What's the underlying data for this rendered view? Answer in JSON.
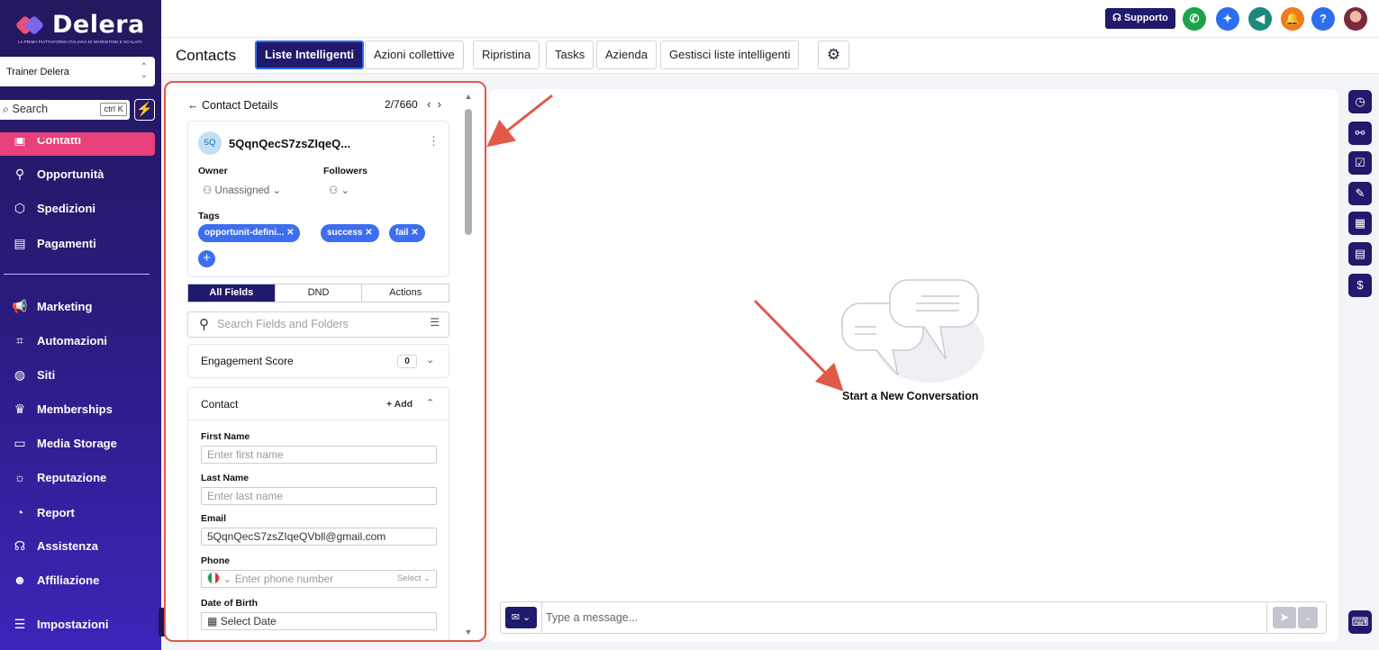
{
  "sidebar": {
    "logo": "Delera",
    "logo_tagline": "LA PRIMA PIATTAFORMA ITALIANA DI MARKETING E SCALATA",
    "account": "Trainer Delera",
    "search_label": "Search",
    "search_shortcut": "ctrl K",
    "items": [
      {
        "label": "Contatti",
        "icon": "contacts-icon"
      },
      {
        "label": "Opportunità",
        "icon": "filter-icon"
      },
      {
        "label": "Spedizioni",
        "icon": "box-icon"
      },
      {
        "label": "Pagamenti",
        "icon": "receipt-icon"
      },
      {
        "label": "Marketing",
        "icon": "megaphone-icon"
      },
      {
        "label": "Automazioni",
        "icon": "workflow-icon"
      },
      {
        "label": "Siti",
        "icon": "globe-icon"
      },
      {
        "label": "Memberships",
        "icon": "crown-icon"
      },
      {
        "label": "Media Storage",
        "icon": "storage-icon"
      },
      {
        "label": "Reputazione",
        "icon": "sun-icon"
      },
      {
        "label": "Report",
        "icon": "pie-chart-icon"
      },
      {
        "label": "Assistenza",
        "icon": "headset-icon"
      },
      {
        "label": "Affiliazione",
        "icon": "user-plus-icon"
      },
      {
        "label": "Impostazioni",
        "icon": "sliders-icon"
      }
    ]
  },
  "topbar": {
    "support_label": "Supporto",
    "icons": [
      {
        "name": "phone-icon",
        "color": "#1aa34a"
      },
      {
        "name": "ai-sparkle-icon",
        "color": "#2d6df0"
      },
      {
        "name": "announcement-icon",
        "color": "#1b8a7a"
      },
      {
        "name": "notification-bell-icon",
        "color": "#f07b1d"
      },
      {
        "name": "help-icon",
        "color": "#2d6df0"
      }
    ]
  },
  "tabs": {
    "title": "Contacts",
    "items": [
      "Liste Intelligenti",
      "Azioni collettive",
      "Ripristina",
      "Tasks",
      "Azienda",
      "Gestisci liste intelligenti"
    ]
  },
  "contact": {
    "header": "Contact Details",
    "position": "2/7660",
    "initials": "5Q",
    "name": "5QqnQecS7zsZIqeQ...",
    "owner_label": "Owner",
    "owner_value": "Unassigned",
    "followers_label": "Followers",
    "tags_label": "Tags",
    "tags": [
      "opportunit-defini...",
      "success",
      "fail"
    ],
    "segments": [
      "All Fields",
      "DND",
      "Actions"
    ],
    "field_search_placeholder": "Search Fields and Folders",
    "engagement_label": "Engagement Score",
    "engagement_value": "0",
    "contact_section": "Contact",
    "add_label": "Add",
    "fields": {
      "first_name_label": "First Name",
      "first_name_placeholder": "Enter first name",
      "last_name_label": "Last Name",
      "last_name_placeholder": "Enter last name",
      "email_label": "Email",
      "email_value": "5QqnQecS7zsZIqeQVbll@gmail.com",
      "phone_label": "Phone",
      "phone_placeholder": "Enter phone number",
      "phone_select": "Select",
      "dob_label": "Date of Birth",
      "dob_placeholder": "Select Date"
    }
  },
  "conversation": {
    "empty_text": "Start a New Conversation",
    "message_placeholder": "Type a message..."
  },
  "right_rail": [
    "history-icon",
    "share-nodes-icon",
    "clipboard-check-icon",
    "pencil-icon",
    "calendar-icon",
    "document-icon",
    "dollar-icon",
    "keyboard-icon"
  ],
  "colors": {
    "brand_dark": "#1f1a6b",
    "accent_pink": "#e8407a",
    "tag_blue": "#3d6ef0",
    "annotation_red": "#e05a47"
  }
}
